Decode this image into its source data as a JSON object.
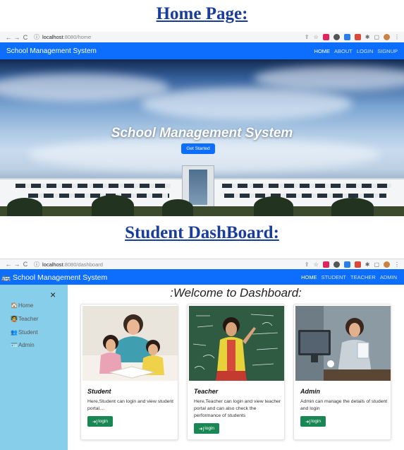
{
  "headings": {
    "home": "Home Page:",
    "dashboard": "Student DashBoard:"
  },
  "browser1": {
    "host": "localhost",
    "path": ":8080/home",
    "back": "←",
    "forward": "→",
    "reload": "C",
    "info": "ⓘ"
  },
  "browser2": {
    "host": "localhost",
    "path": ":8080/dashboard",
    "back": "←",
    "forward": "→",
    "reload": "C",
    "info": "ⓘ"
  },
  "home_nav": {
    "brand": "School Management System",
    "links": [
      "HOME",
      "ABOUT",
      "LOGIN",
      "SIGNUP"
    ]
  },
  "hero": {
    "title": "School Management System",
    "button": "Get Started"
  },
  "dash_nav": {
    "brand_icon": "🚌",
    "brand": "School Management System",
    "links": [
      "HOME",
      "STUDENT",
      "TEACHER",
      "ADMIN"
    ]
  },
  "sidebar": {
    "close": "×",
    "items": [
      {
        "icon": "🏠",
        "label": "Home"
      },
      {
        "icon": "🧑‍🏫",
        "label": "Teacher"
      },
      {
        "icon": "👥",
        "label": "Student"
      },
      {
        "icon": "🪪",
        "label": "Admin"
      }
    ]
  },
  "welcome": ":Welcome to Dashboard:",
  "cards": [
    {
      "title": "Student",
      "text": "Here,Student can login and view student portal....",
      "button": "login"
    },
    {
      "title": "Teacher",
      "text": "Here,Teacher can login and view teacher portal and can also check the performance of students",
      "button": "login"
    },
    {
      "title": "Admin",
      "text": "Admin can manage the details of student and login",
      "button": "login"
    }
  ],
  "colors": {
    "primary": "#0d6efd",
    "success": "#198754",
    "sidebar": "#87ceeb",
    "heading": "#1a3d9c"
  }
}
